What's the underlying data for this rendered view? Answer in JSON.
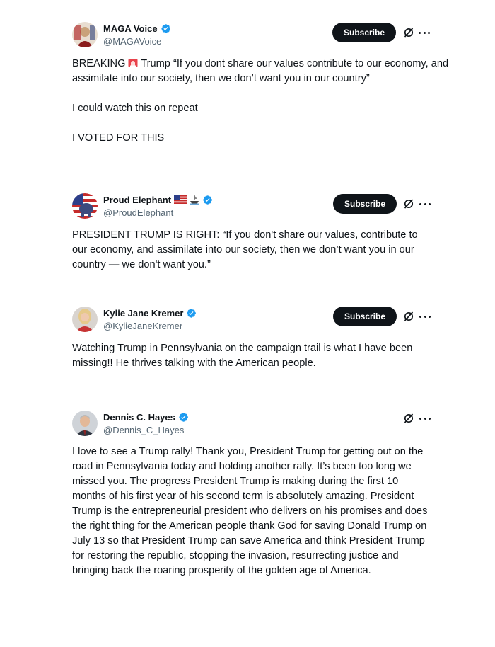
{
  "posts": [
    {
      "display_name": "MAGA Voice",
      "handle": "@MAGAVoice",
      "subscribe_label": "Subscribe",
      "text": {
        "line1_pre": "BREAKING",
        "line1_post": "Trump “If you dont share our values contribute to our economy, and assimilate into our society, then we don’t want you in our country”",
        "line2": "I could watch this on repeat",
        "line3": "I VOTED FOR THIS"
      },
      "icons": [
        "verified-badge-icon",
        "siren-emoji-icon",
        "grok-icon",
        "more-icon"
      ]
    },
    {
      "display_name": "Proud Elephant",
      "handle": "@ProudElephant",
      "subscribe_label": "Subscribe",
      "text": {
        "line1": "PRESIDENT TRUMP IS RIGHT: “If you don't share our values, contribute to our economy, and assimilate into our society, then we don’t want you in our country — we don't want you.”"
      },
      "icons": [
        "us-flag-icon",
        "ship-icon",
        "verified-badge-icon",
        "grok-icon",
        "more-icon"
      ]
    },
    {
      "display_name": "Kylie Jane Kremer",
      "handle": "@KylieJaneKremer",
      "subscribe_label": "Subscribe",
      "text": {
        "line1": "Watching Trump in Pennsylvania on the campaign trail is what I have been missing!! He thrives talking with the American people."
      },
      "icons": [
        "verified-badge-icon",
        "grok-icon",
        "more-icon"
      ]
    },
    {
      "display_name": "Dennis C. Hayes",
      "handle": "@Dennis_C_Hayes",
      "text": {
        "line1": "I love to see a Trump rally! Thank you, President Trump for getting out on the road in Pennsylvania today and holding another rally. It’s been too long we missed you. The progress President Trump is making during the first 10 months of his first year of his second term is absolutely amazing. President Trump is the entrepreneurial president who delivers on his promises and does the right thing for the American people thank God for saving Donald Trump on July 13 so that President Trump can save America and think President Trump for restoring the republic, stopping the invasion, resurrecting justice and bringing back the roaring prosperity of the golden age of America."
      },
      "icons": [
        "verified-badge-icon",
        "grok-icon",
        "more-icon"
      ]
    }
  ],
  "colors": {
    "verified": "#1d9bf0",
    "subscribe_bg": "#0f1419",
    "handle": "#536471",
    "text": "#0f1419"
  }
}
